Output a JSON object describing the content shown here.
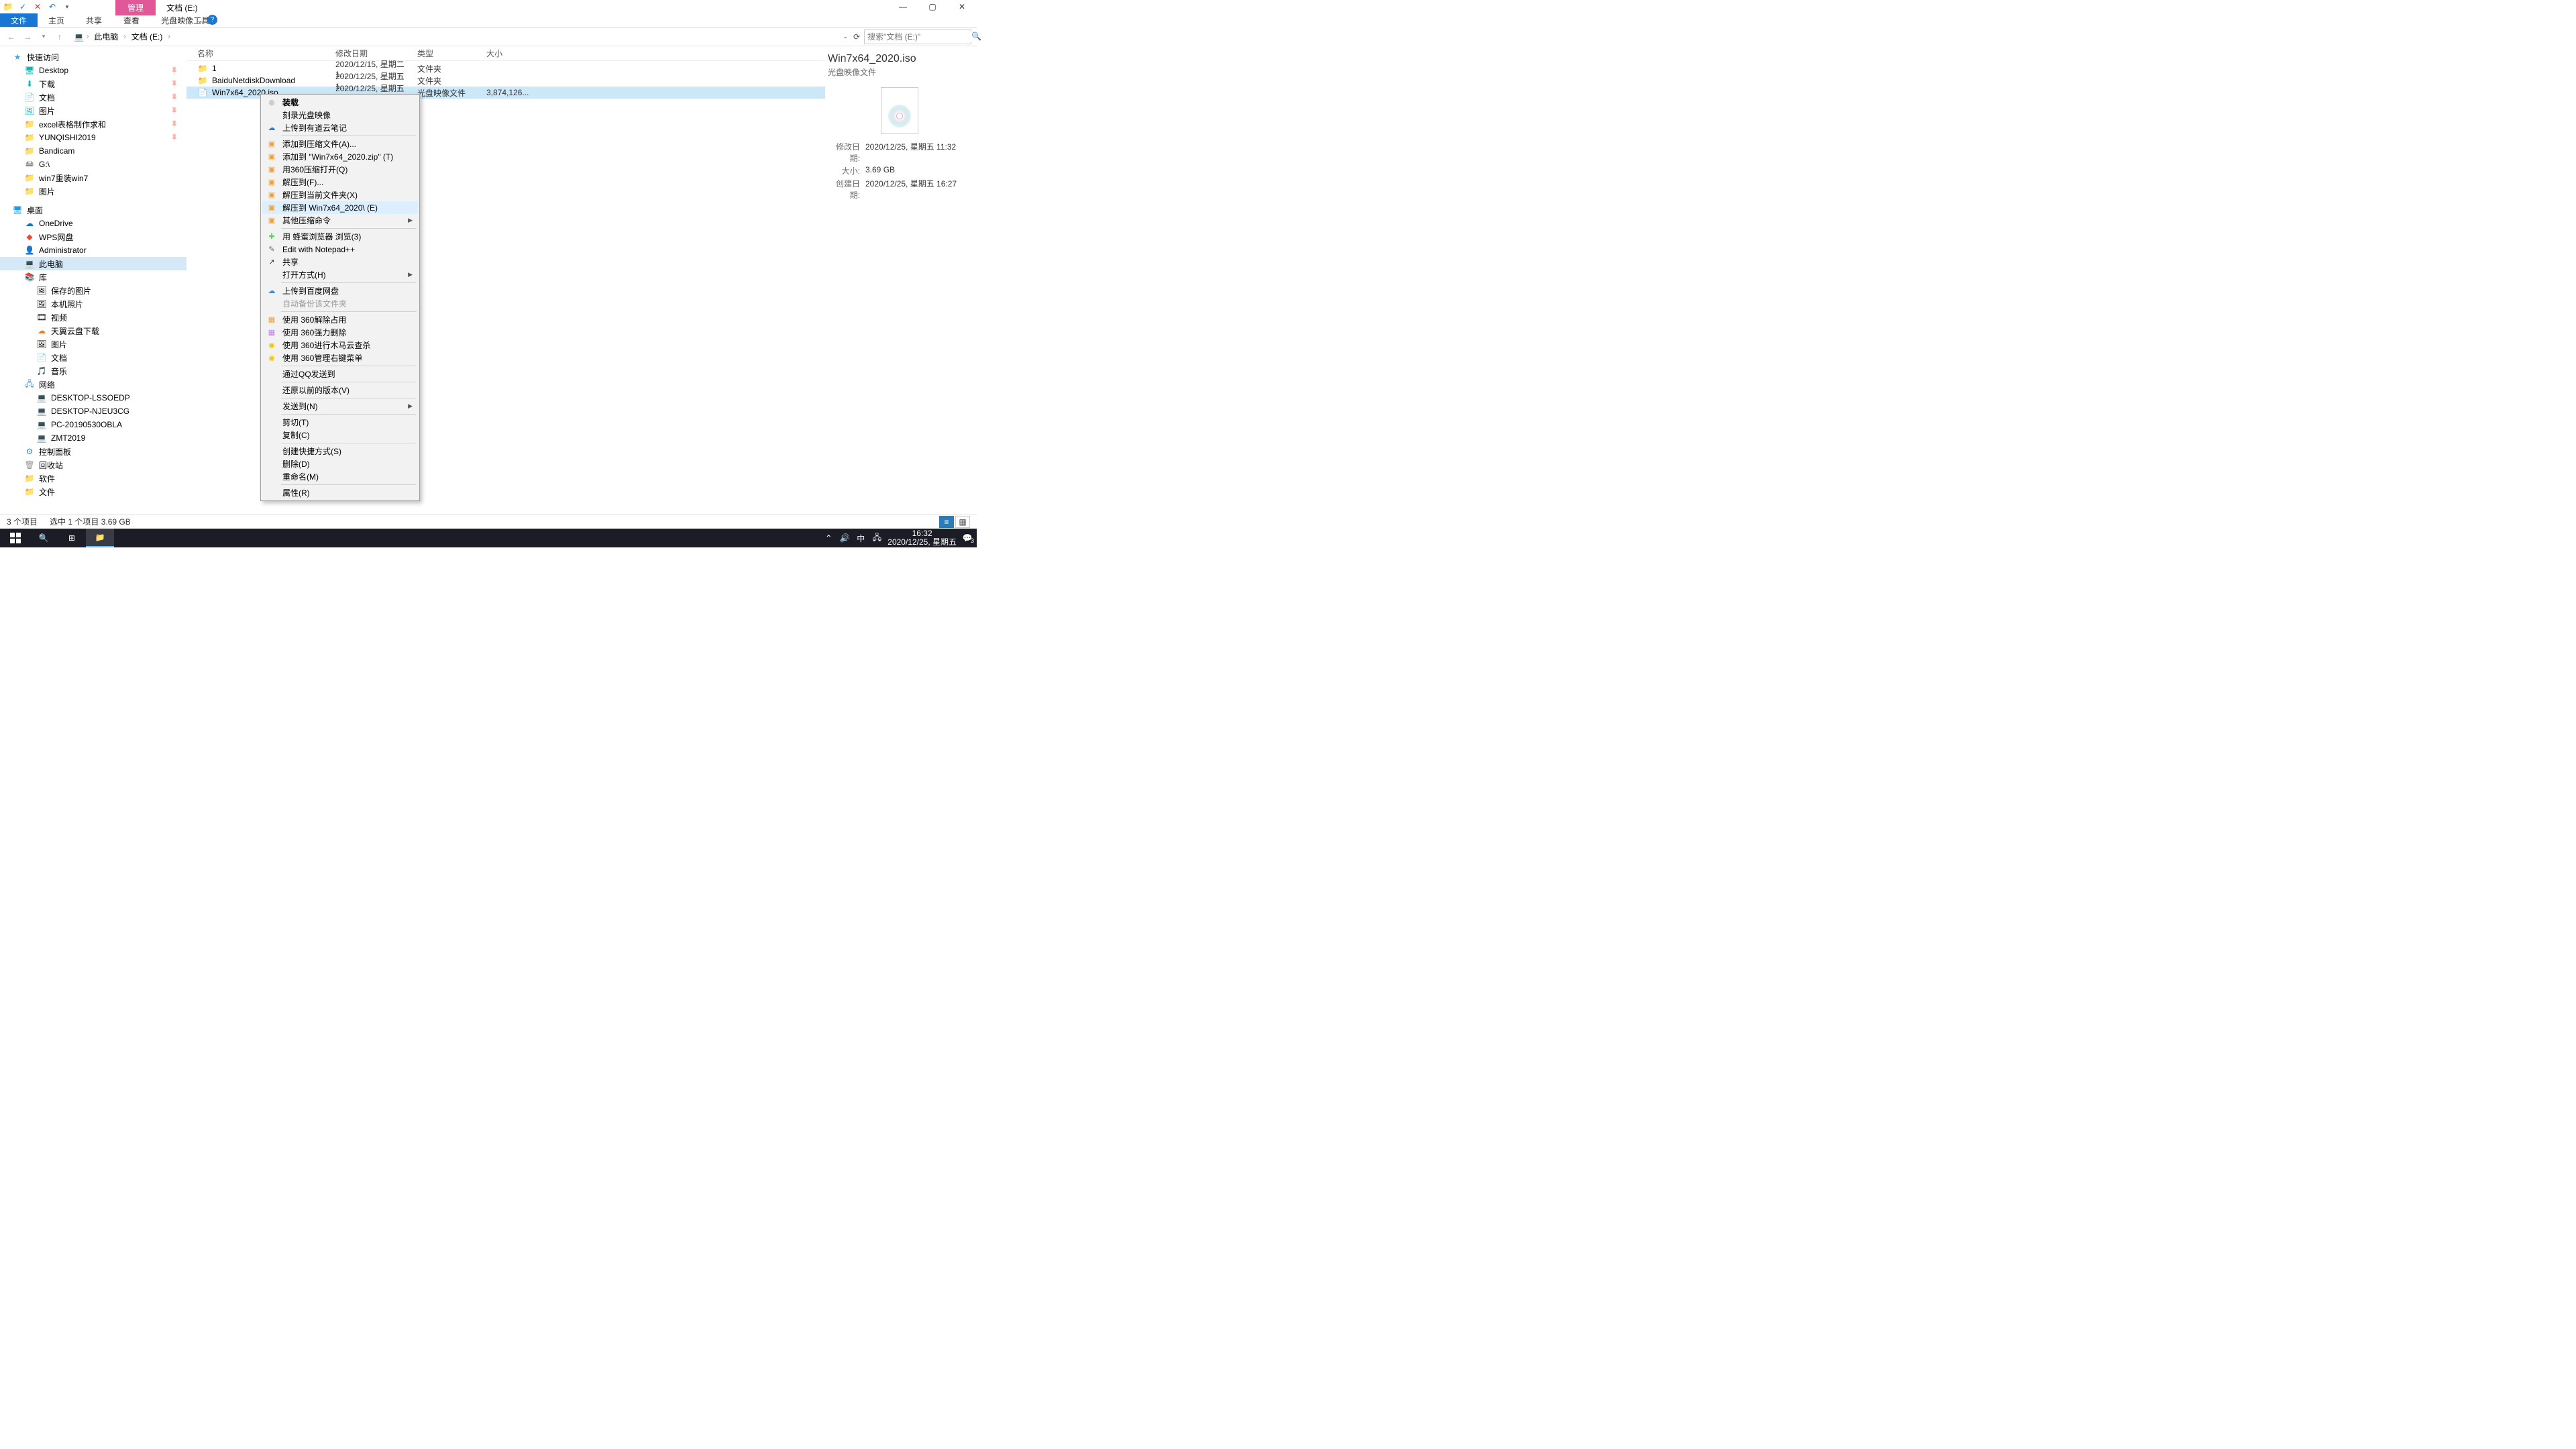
{
  "titlebar": {
    "tab_manage": "管理",
    "title_path": "文档 (E:)"
  },
  "ribbon": {
    "file": "文件",
    "home": "主页",
    "share": "共享",
    "view": "查看",
    "tools": "光盘映像工具"
  },
  "breadcrumb": {
    "pc": "此电脑",
    "doc": "文档 (E:)",
    "sep": "›"
  },
  "search": {
    "placeholder": "搜索\"文档 (E:)\""
  },
  "nav": {
    "quick_access": "快速访问",
    "desktop": "Desktop",
    "downloads": "下载",
    "documents": "文档",
    "pictures": "图片",
    "excel": "excel表格制作求和",
    "yunqishi": "YUNQISHI2019",
    "bandicam": "Bandicam",
    "g_drive": "G:\\",
    "win7reinstall": "win7重装win7",
    "pictures2": "图片",
    "desktop_root": "桌面",
    "onedrive": "OneDrive",
    "wps": "WPS网盘",
    "admin": "Administrator",
    "thispc": "此电脑",
    "libs": "库",
    "saved_pics": "保存的图片",
    "local_photos": "本机照片",
    "videos": "视频",
    "tianyi": "天翼云盘下载",
    "lib_pics": "图片",
    "lib_docs": "文档",
    "lib_music": "音乐",
    "network": "网络",
    "net1": "DESKTOP-LSSOEDP",
    "net2": "DESKTOP-NJEU3CG",
    "net3": "PC-20190530OBLA",
    "net4": "ZMT2019",
    "control_panel": "控制面板",
    "recycle": "回收站",
    "software": "软件",
    "files": "文件"
  },
  "columns": {
    "name": "名称",
    "date": "修改日期",
    "type": "类型",
    "size": "大小"
  },
  "files": [
    {
      "name": "1",
      "date": "2020/12/15, 星期二 1...",
      "type": "文件夹",
      "size": "",
      "icon": "folder"
    },
    {
      "name": "BaiduNetdiskDownload",
      "date": "2020/12/25, 星期五 1...",
      "type": "文件夹",
      "size": "",
      "icon": "folder"
    },
    {
      "name": "Win7x64_2020.iso",
      "date": "2020/12/25, 星期五 1...",
      "type": "光盘映像文件",
      "size": "3,874,126...",
      "icon": "iso",
      "selected": true
    }
  ],
  "details": {
    "title": "Win7x64_2020.iso",
    "type": "光盘映像文件",
    "modified_label": "修改日期:",
    "modified": "2020/12/25, 星期五 11:32",
    "size_label": "大小:",
    "size": "3.69 GB",
    "created_label": "创建日期:",
    "created": "2020/12/25, 星期五 16:27"
  },
  "status": {
    "items": "3 个项目",
    "selection": "选中 1 个项目  3.69 GB"
  },
  "context": [
    {
      "label": "装载",
      "bold": true,
      "icon_color": "#ccc",
      "glyph": "◉"
    },
    {
      "label": "刻录光盘映像"
    },
    {
      "label": "上传到有道云笔记",
      "icon_color": "#2c7be5",
      "glyph": "☁"
    },
    {
      "sep": true
    },
    {
      "label": "添加到压缩文件(A)...",
      "icon_color": "#e8a23d",
      "glyph": "▣"
    },
    {
      "label": "添加到 \"Win7x64_2020.zip\" (T)",
      "icon_color": "#e8a23d",
      "glyph": "▣"
    },
    {
      "label": "用360压缩打开(Q)",
      "icon_color": "#e8a23d",
      "glyph": "▣"
    },
    {
      "label": "解压到(F)...",
      "icon_color": "#e8a23d",
      "glyph": "▣"
    },
    {
      "label": "解压到当前文件夹(X)",
      "icon_color": "#e8a23d",
      "glyph": "▣"
    },
    {
      "label": "解压到 Win7x64_2020\\ (E)",
      "icon_color": "#e8a23d",
      "glyph": "▣",
      "highlight": true
    },
    {
      "label": "其他压缩命令",
      "icon_color": "#e8a23d",
      "glyph": "▣",
      "arrow": true
    },
    {
      "sep": true
    },
    {
      "label": "用 蜂蜜浏览器 浏览(3)",
      "icon_color": "#5bd16a",
      "glyph": "✚"
    },
    {
      "label": "Edit with Notepad++",
      "icon_color": "#3e8e41",
      "glyph": "✎"
    },
    {
      "label": "共享",
      "icon_color": "#333",
      "glyph": "↗"
    },
    {
      "label": "打开方式(H)",
      "arrow": true
    },
    {
      "sep": true
    },
    {
      "label": "上传到百度网盘",
      "icon_color": "#3a8de0",
      "glyph": "☁"
    },
    {
      "label": "自动备份该文件夹",
      "disabled": true
    },
    {
      "sep": true
    },
    {
      "label": "使用 360解除占用",
      "icon_color": "#e8a23d",
      "glyph": "▦"
    },
    {
      "label": "使用 360强力删除",
      "icon_color": "#c080e8",
      "glyph": "▦"
    },
    {
      "label": "使用 360进行木马云查杀",
      "icon_color": "#f2c500",
      "glyph": "◉"
    },
    {
      "label": "使用 360管理右键菜单",
      "icon_color": "#f2c500",
      "glyph": "◉"
    },
    {
      "sep": true
    },
    {
      "label": "通过QQ发送到"
    },
    {
      "sep": true
    },
    {
      "label": "还原以前的版本(V)"
    },
    {
      "sep": true
    },
    {
      "label": "发送到(N)",
      "arrow": true
    },
    {
      "sep": true
    },
    {
      "label": "剪切(T)"
    },
    {
      "label": "复制(C)"
    },
    {
      "sep": true
    },
    {
      "label": "创建快捷方式(S)"
    },
    {
      "label": "删除(D)"
    },
    {
      "label": "重命名(M)"
    },
    {
      "sep": true
    },
    {
      "label": "属性(R)"
    }
  ],
  "taskbar": {
    "clock_time": "16:32",
    "clock_date": "2020/12/25, 星期五",
    "ime": "中",
    "notif": "3"
  }
}
